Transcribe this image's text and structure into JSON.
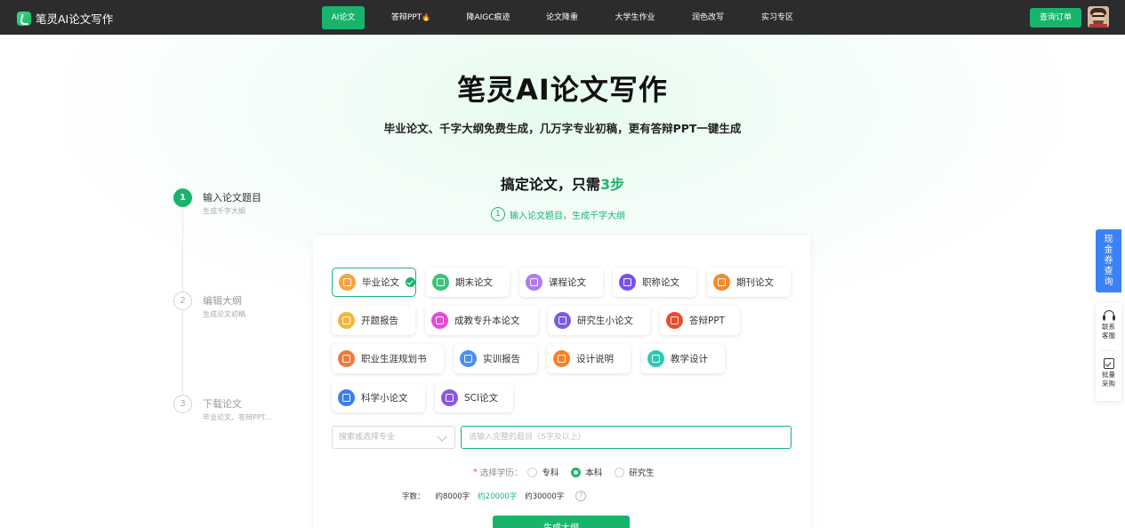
{
  "header": {
    "logo_text": "笔灵AI论文写作",
    "nav": [
      {
        "label": "AI论文",
        "active": true
      },
      {
        "label": "答辩PPT",
        "badge": "fire-icon"
      },
      {
        "label": "降AIGC痕迹"
      },
      {
        "label": "论文降重"
      },
      {
        "label": "大学生作业"
      },
      {
        "label": "润色改写"
      },
      {
        "label": "实习专区"
      }
    ],
    "order_button": "查询订单"
  },
  "hero": {
    "title": "笔灵AI论文写作",
    "subtitle": "毕业论文、千字大纲免费生成，几万字专业初稿，更有答辩PPT一键生成"
  },
  "steps_heading": {
    "prefix": "搞定论文，只需",
    "highlight": "3步"
  },
  "step_hint": {
    "num": "1",
    "text": "输入论文题目，生成千字大纲"
  },
  "stepper": [
    {
      "num": "1",
      "title": "输入论文题目",
      "desc": "生成千字大纲",
      "active": true
    },
    {
      "num": "2",
      "title": "编辑大纲",
      "desc": "生成论文初稿",
      "active": false
    },
    {
      "num": "3",
      "title": "下载论文",
      "desc": "毕业论文、答辩PPT...",
      "active": false
    }
  ],
  "paper_types": [
    {
      "label": "毕业论文",
      "icon": "graduation-paper-icon",
      "color": "#f7a23c",
      "selected": true
    },
    {
      "label": "期末论文",
      "icon": "pen-paper-icon",
      "color": "#3dc27a"
    },
    {
      "label": "课程论文",
      "icon": "course-book-icon",
      "color": "#b17af0"
    },
    {
      "label": "职称论文",
      "icon": "title-doc-icon",
      "color": "#7a4ff0"
    },
    {
      "label": "期刊论文",
      "icon": "journal-icon",
      "color": "#f58a2a"
    },
    {
      "label": "开题报告",
      "icon": "proposal-report-icon",
      "color": "#f5b53c"
    },
    {
      "label": "成教专升本论文",
      "icon": "adult-edu-icon",
      "color": "#e54ad4"
    },
    {
      "label": "研究生小论文",
      "icon": "graduate-doc-icon",
      "color": "#7b5ae8"
    },
    {
      "label": "答辩PPT",
      "icon": "ppt-icon",
      "color": "#f04a2a"
    },
    {
      "label": "职业生涯规划书",
      "icon": "career-plan-icon",
      "color": "#f07a3a"
    },
    {
      "label": "实训报告",
      "icon": "training-report-icon",
      "color": "#4a8ef5"
    },
    {
      "label": "设计说明",
      "icon": "design-chart-icon",
      "color": "#f5822a"
    },
    {
      "label": "教学设计",
      "icon": "teaching-design-icon",
      "color": "#2ec9b4"
    },
    {
      "label": "科学小论文",
      "icon": "atom-icon",
      "color": "#3b7ef0"
    },
    {
      "label": "SCI论文",
      "icon": "sci-doc-icon",
      "color": "#8a55e8"
    }
  ],
  "form": {
    "major_placeholder": "搜索或选择专业",
    "title_placeholder": "请输入完整的题目（5字及以上）",
    "edu_label": "选择学历：",
    "edu_required": "*",
    "edu_options": [
      {
        "label": "专科",
        "checked": false
      },
      {
        "label": "本科",
        "checked": true
      },
      {
        "label": "研究生",
        "checked": false
      }
    ],
    "words_label": "字数：",
    "word_options": [
      {
        "label": "约8000字",
        "selected": false
      },
      {
        "label": "约20000字",
        "selected": true
      },
      {
        "label": "约30000字",
        "selected": false
      }
    ],
    "help": "?",
    "generate_button": "生成大纲"
  },
  "side": {
    "coupon": [
      "现",
      "金",
      "券",
      "查",
      "询"
    ],
    "contact": [
      "联系",
      "客服"
    ],
    "bulk": [
      "批量",
      "采购"
    ]
  },
  "colors": {
    "accent": "#19b46c",
    "header_bg": "#2c2c2e",
    "coupon_bg": "#3b82f6"
  }
}
